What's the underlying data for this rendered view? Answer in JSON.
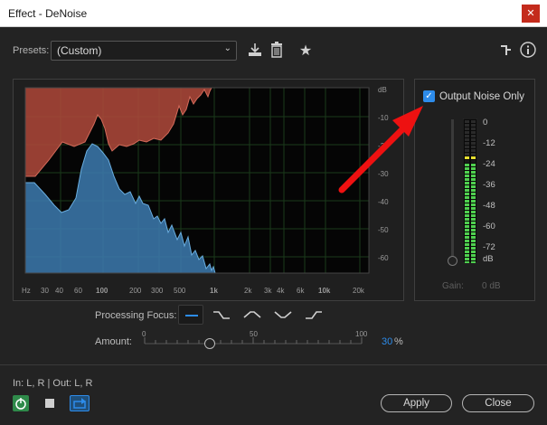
{
  "window": {
    "title": "Effect - DeNoise",
    "close_glyph": "✕"
  },
  "presets": {
    "label": "Presets:",
    "value": "(Custom)"
  },
  "toolbar_icons": [
    "save-preset-icon",
    "delete-preset-icon",
    "favorite-star-icon",
    "routing-icon",
    "info-icon"
  ],
  "graph": {
    "y_ticks": [
      "dB",
      "-10",
      "-20",
      "-30",
      "-40",
      "-50",
      "-60"
    ],
    "x_ticks": [
      "Hz",
      "30",
      "40",
      "60",
      "100",
      "200",
      "300",
      "500",
      "1k",
      "2k",
      "3k",
      "4k",
      "6k",
      "10k",
      "20k"
    ]
  },
  "output_noise_only": {
    "label": "Output Noise Only",
    "checked": true
  },
  "meter": {
    "ticks": [
      "0",
      "-12",
      "-24",
      "-36",
      "-48",
      "-60",
      "-72",
      "dB"
    ],
    "colors": {
      "green": "#4fd04f",
      "yellow": "#e8e030"
    }
  },
  "gain": {
    "label": "Gain:",
    "value": "0 dB"
  },
  "processing_focus": {
    "label": "Processing Focus:"
  },
  "amount": {
    "label": "Amount:",
    "ticks": [
      "0",
      "50",
      "100"
    ],
    "value": "30",
    "unit": "%",
    "level": 0.3
  },
  "io": {
    "label": "In: L, R | Out: L, R"
  },
  "buttons": {
    "apply": "Apply",
    "close": "Close"
  },
  "accent_color": "#2d8ceb",
  "annotation_color": "#ee1111"
}
